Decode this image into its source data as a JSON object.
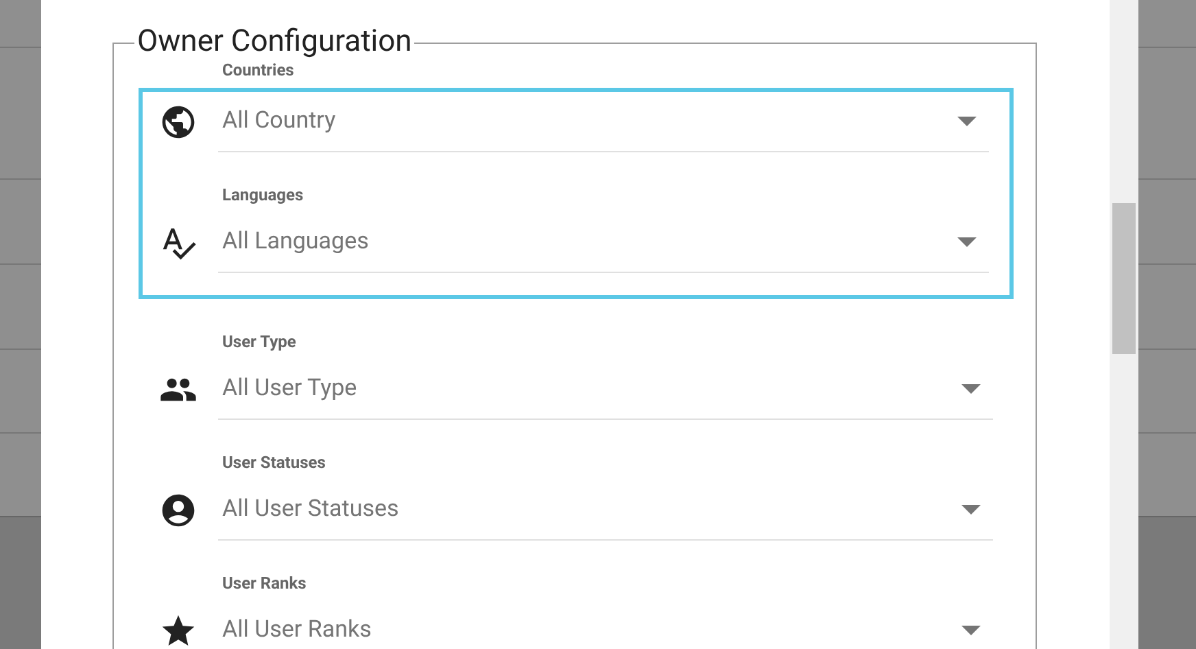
{
  "section": {
    "title": "Owner Configuration"
  },
  "filters": [
    {
      "kind": "globe",
      "label": "Countries",
      "value": "All Country",
      "highlighted": true
    },
    {
      "kind": "spellcheck",
      "label": "Languages",
      "value": "All Languages",
      "highlighted": true
    },
    {
      "kind": "people",
      "label": "User Type",
      "value": "All User Type",
      "highlighted": false
    },
    {
      "kind": "account",
      "label": "User Statuses",
      "value": "All User Statuses",
      "highlighted": false
    },
    {
      "kind": "star",
      "label": "User Ranks",
      "value": "All User Ranks",
      "highlighted": false
    }
  ]
}
